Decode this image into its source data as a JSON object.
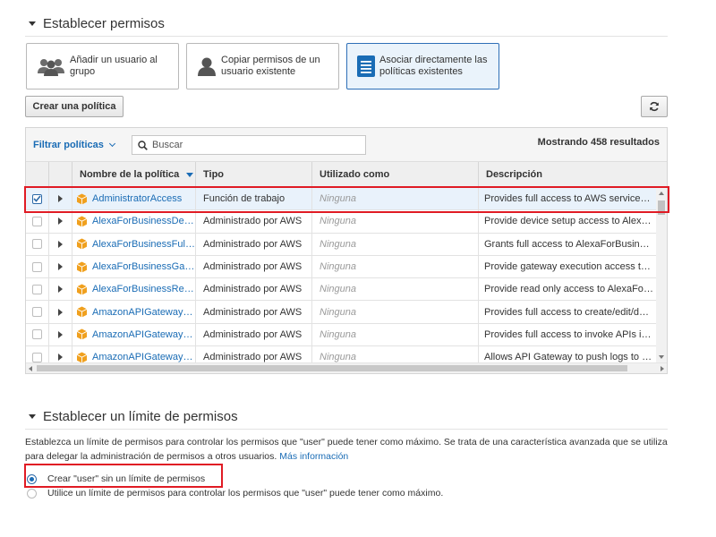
{
  "permissions": {
    "title": "Establecer permisos",
    "options": [
      {
        "label": "Añadir un usuario al grupo",
        "icon": "group-icon",
        "active": false
      },
      {
        "label": "Copiar permisos de un usuario existente",
        "icon": "user-icon",
        "active": false
      },
      {
        "label": "Asociar directamente las políticas existentes",
        "icon": "document-icon",
        "active": true
      }
    ],
    "create_policy_label": "Crear una política",
    "refresh_icon": "refresh-icon"
  },
  "table": {
    "filter_label": "Filtrar políticas",
    "search_placeholder": "Buscar",
    "showing_text": "Mostrando 458 resultados",
    "columns": [
      "Nombre de la política",
      "Tipo",
      "Utilizado como",
      "Descripción"
    ],
    "rows": [
      {
        "name": "AdministratorAccess",
        "type": "Función de trabajo",
        "used": "Ninguna",
        "desc": "Provides full access to AWS services and resources.",
        "checked": true
      },
      {
        "name": "AlexaForBusinessDeviceSetup",
        "type": "Administrado por AWS",
        "used": "Ninguna",
        "desc": "Provide device setup access to AlexaForBusiness services",
        "checked": false
      },
      {
        "name": "AlexaForBusinessFullAccess",
        "type": "Administrado por AWS",
        "used": "Ninguna",
        "desc": "Grants full access to AlexaForBusiness resources and access",
        "checked": false
      },
      {
        "name": "AlexaForBusinessGatewayExecution",
        "type": "Administrado por AWS",
        "used": "Ninguna",
        "desc": "Provide gateway execution access to AlexaForBusiness services",
        "checked": false
      },
      {
        "name": "AlexaForBusinessReadOnlyAccess",
        "type": "Administrado por AWS",
        "used": "Ninguna",
        "desc": "Provide read only access to AlexaForBusiness services",
        "checked": false
      },
      {
        "name": "AmazonAPIGatewayAdministrator",
        "type": "Administrado por AWS",
        "used": "Ninguna",
        "desc": "Provides full access to create/edit/delete APIs in Amazon API Gateway",
        "checked": false
      },
      {
        "name": "AmazonAPIGatewayInvokeFullAccess",
        "type": "Administrado por AWS",
        "used": "Ninguna",
        "desc": "Provides full access to invoke APIs in Amazon API Gateway",
        "checked": false
      },
      {
        "name": "AmazonAPIGatewayPushToCloudWatchLogs",
        "type": "Administrado por AWS",
        "used": "Ninguna",
        "desc": "Allows API Gateway to push logs to user's account",
        "checked": false
      }
    ]
  },
  "boundary": {
    "title": "Establecer un límite de permisos",
    "description": "Establezca un límite de permisos para controlar los permisos que \"user\" puede tener como máximo. Se trata de una característica avanzada que se utiliza para delegar la administración de permisos a otros usuarios.",
    "more_info": "Más información",
    "radio_options": [
      {
        "label": "Crear \"user\" sin un límite de permisos",
        "selected": true
      },
      {
        "label": "Utilice un límite de permisos para controlar los permisos que \"user\" puede tener como máximo.",
        "selected": false
      }
    ]
  },
  "colors": {
    "accent": "#1a6cb5",
    "highlight": "#e01b24",
    "policy_icon": "#f0a01e"
  }
}
